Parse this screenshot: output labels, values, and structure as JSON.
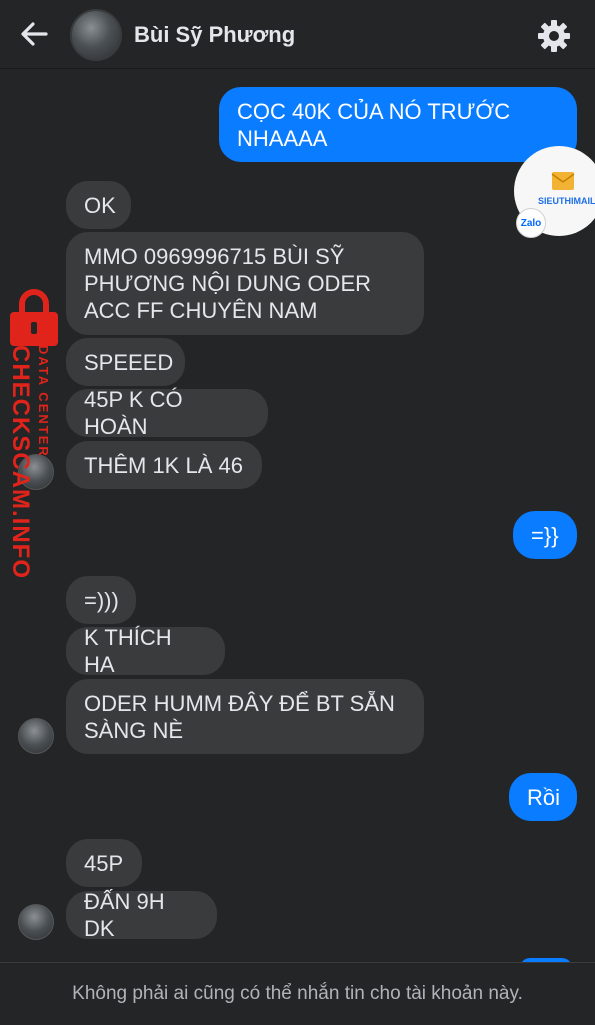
{
  "header": {
    "title": "Bùi Sỹ Phương"
  },
  "messages": [
    {
      "id": "m1",
      "dir": "out",
      "text": "CỌC 40K CỦA NÓ TRƯỚC NHAAAA"
    },
    {
      "id": "m2",
      "dir": "in",
      "text": "OK"
    },
    {
      "id": "m3",
      "dir": "in",
      "text": "MMO 0969996715 BÙI SỸ PHƯƠNG NỘI DUNG ODER ACC FF CHUYÊN NAM"
    },
    {
      "id": "m4",
      "dir": "in",
      "text": "SPEEED"
    },
    {
      "id": "m5",
      "dir": "in",
      "text": "45P K CÓ HOÀN"
    },
    {
      "id": "m6",
      "dir": "in",
      "text": "THÊM 1K LÀ 46"
    },
    {
      "id": "m7",
      "dir": "out",
      "text": "=}}"
    },
    {
      "id": "m8",
      "dir": "in",
      "text": "=)))"
    },
    {
      "id": "m9",
      "dir": "in",
      "text": "K THÍCH HA"
    },
    {
      "id": "m10",
      "dir": "in",
      "text": "ODER HUMM ĐÂY ĐỂ BT SẴN SÀNG NÈ"
    },
    {
      "id": "m11",
      "dir": "out",
      "text": "Rồi"
    },
    {
      "id": "m12",
      "dir": "in",
      "text": "45P"
    },
    {
      "id": "m13",
      "dir": "in",
      "text": "ĐẤN 9H DK"
    }
  ],
  "footer": {
    "notice": "Không phải ai cũng có thể nhắn tin cho tài khoản này."
  },
  "watermark": {
    "main": "CHECKSCAM.INFO",
    "sub": "DATA CENTER"
  },
  "sticker": {
    "brand": "SIEUTHIMAIL.VN",
    "app": "Zalo"
  },
  "colors": {
    "background": "#242526",
    "incoming_bubble": "#3a3b3c",
    "outgoing_bubble": "#0a7cff",
    "watermark": "#e0241b"
  }
}
